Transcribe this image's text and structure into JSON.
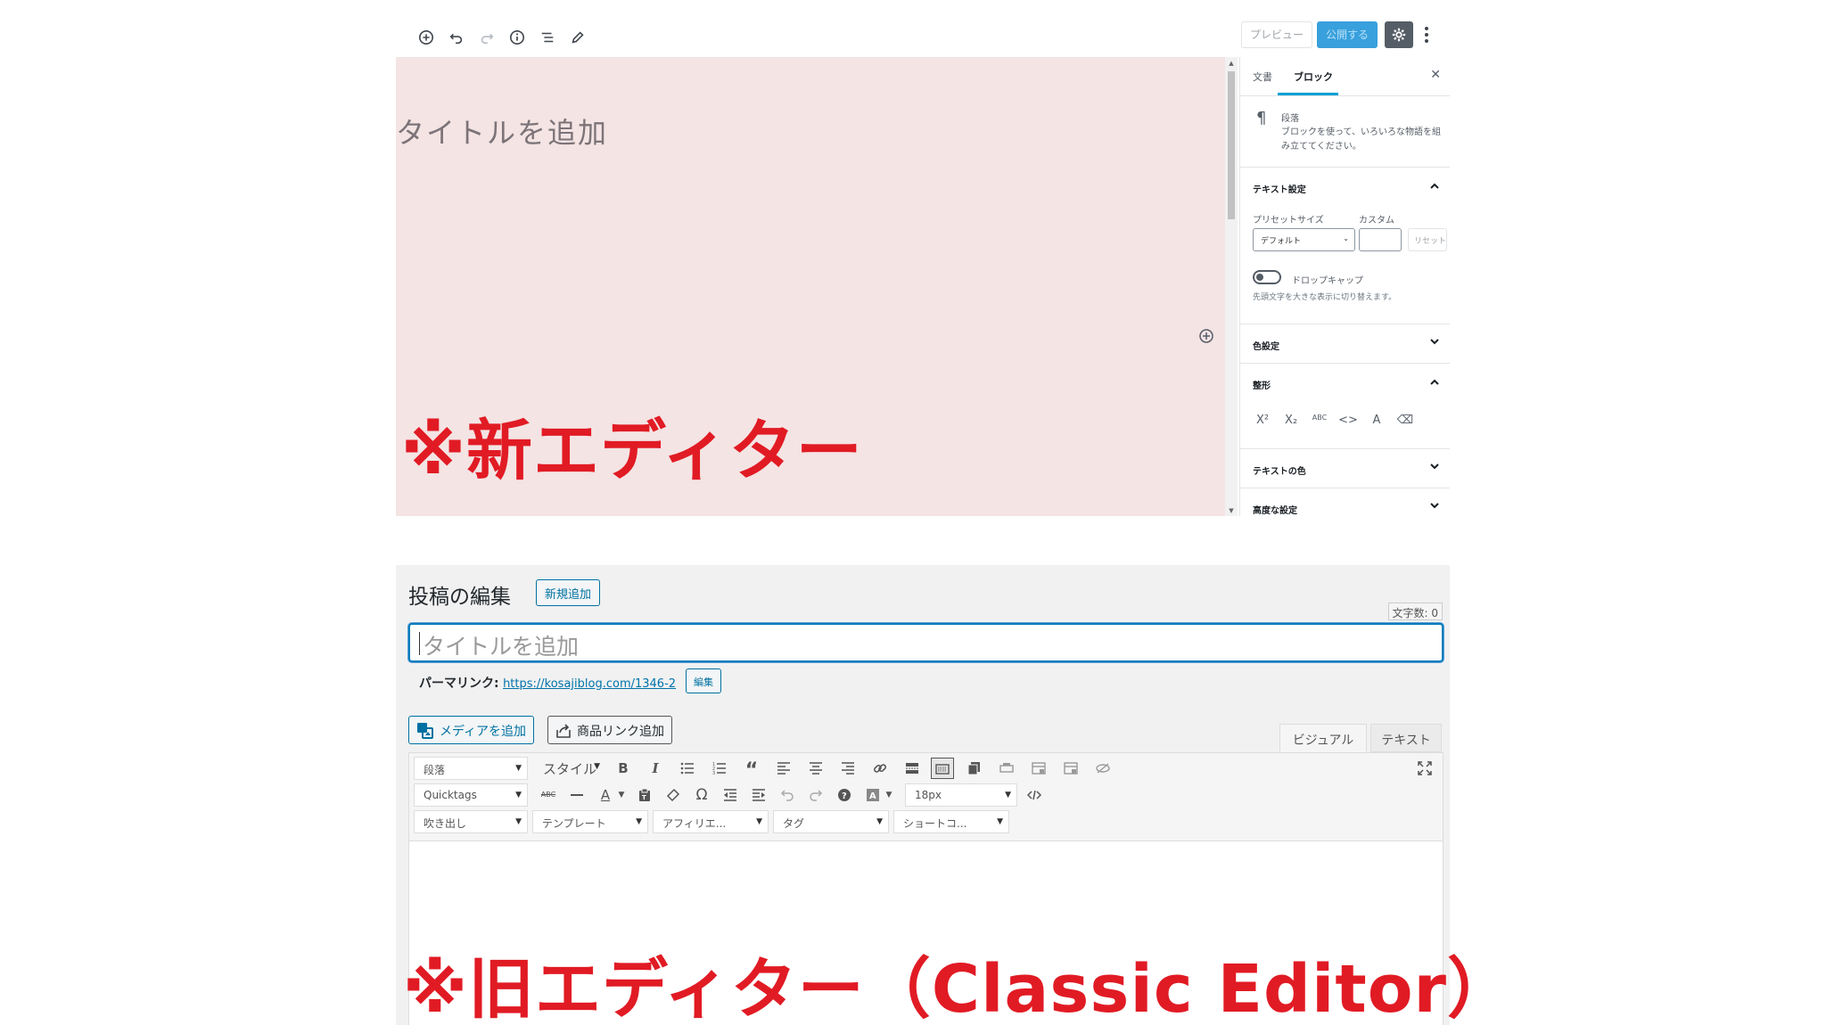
{
  "new_editor": {
    "toolbar": {
      "icons": [
        "add-block-icon",
        "undo-icon",
        "redo-icon",
        "info-icon",
        "outline-icon",
        "edit-mode-icon"
      ],
      "preview_label": "プレビュー",
      "publish_label": "公開する"
    },
    "title_placeholder": "タイトルを追加",
    "caption": "※新エディター",
    "sidebar": {
      "tabs": [
        "文書",
        "ブロック"
      ],
      "active_tab": "ブロック",
      "block": {
        "name": "段落",
        "description": "ブロックを使って、いろいろな物語を組み立ててください。"
      },
      "text_settings": {
        "title": "テキスト設定",
        "preset_label": "プリセットサイズ",
        "custom_label": "カスタム",
        "preset_value": "デフォルト",
        "reset_label": "リセット",
        "dropcap_label": "ドロップキャップ",
        "dropcap_help": "先頭文字を大きな表示に切り替えます。"
      },
      "color_settings": "色設定",
      "formatting": {
        "title": "整形",
        "buttons": [
          "X²",
          "X₂",
          "ABC",
          "<>",
          "A",
          "⌫"
        ]
      },
      "text_color": "テキストの色",
      "advanced": "高度な設定"
    }
  },
  "classic_editor": {
    "heading": "投稿の編集",
    "new_post_label": "新規追加",
    "char_count": "文字数: 0",
    "title_placeholder": "タイトルを追加",
    "permalink_label": "パーマリンク:",
    "permalink_url": "https://kosajiblog.com/1346-2",
    "permalink_edit": "編集",
    "add_media": "メディアを追加",
    "add_product_link": "商品リンク追加",
    "tab_visual": "ビジュアル",
    "tab_text": "テキスト",
    "row1": {
      "format_select": "段落",
      "style_select": "スタイル",
      "icons": [
        "bold-icon",
        "italic-icon",
        "bulleted-list-icon",
        "numbered-list-icon",
        "blockquote-icon",
        "align-left-icon",
        "align-center-icon",
        "align-right-icon",
        "link-icon",
        "more-tag-icon",
        "toolbar-toggle-icon",
        "copy-icon",
        "print-icon",
        "template-icon",
        "table-icon",
        "hide-icon",
        "fullscreen-icon"
      ]
    },
    "row2": {
      "quicktags_select": "Quicktags",
      "font_size": "18px",
      "icons": [
        "strikethrough-icon",
        "horizontal-line-icon",
        "text-color-icon",
        "paste-text-icon",
        "clear-format-icon",
        "special-char-icon",
        "outdent-icon",
        "indent-icon",
        "undo-icon",
        "redo-icon",
        "help-icon",
        "background-color-icon",
        "code-icon"
      ]
    },
    "row3": {
      "selects": [
        "吹き出し",
        "テンプレート",
        "アフィリエ...",
        "タグ",
        "ショートコ..."
      ]
    }
  },
  "classic_caption": "※旧エディター（Classic Editor）"
}
